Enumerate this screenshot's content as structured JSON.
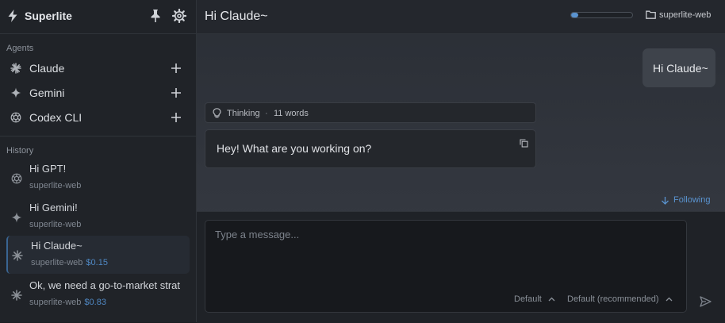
{
  "app": {
    "name": "Superlite"
  },
  "sidebar": {
    "agents_label": "Agents",
    "agents": [
      {
        "label": "Claude",
        "icon": "claude-asterisk-icon"
      },
      {
        "label": "Gemini",
        "icon": "gemini-sparkle-icon"
      },
      {
        "label": "Codex CLI",
        "icon": "openai-knot-icon"
      }
    ],
    "history_label": "History",
    "history": [
      {
        "title": "Hi GPT!",
        "workspace": "superlite-web",
        "cost": "",
        "icon": "openai-knot-icon"
      },
      {
        "title": "Hi Gemini!",
        "workspace": "superlite-web",
        "cost": "",
        "icon": "gemini-sparkle-icon"
      },
      {
        "title": "Hi Claude~",
        "workspace": "superlite-web",
        "cost": "$0.15",
        "icon": "claude-asterisk-icon",
        "active": true
      },
      {
        "title": "Ok, we need a go-to-market strat",
        "workspace": "superlite-web",
        "cost": "$0.83",
        "icon": "claude-asterisk-icon"
      }
    ]
  },
  "main": {
    "title": "Hi Claude~",
    "context_progress": 0.12,
    "workspace": "superlite-web",
    "messages": {
      "user": "Hi Claude~",
      "thinking_label": "Thinking",
      "thinking_separator": "·",
      "thinking_words": "11 words",
      "assistant": "Hey! What are you working on?"
    },
    "following_label": "Following",
    "composer": {
      "placeholder": "Type a message...",
      "mode_select": "Default",
      "model_select": "Default (recommended)"
    }
  },
  "colors": {
    "accent": "#4f87c2",
    "sidebar_bg": "#202328",
    "main_bg": "#32363e"
  }
}
